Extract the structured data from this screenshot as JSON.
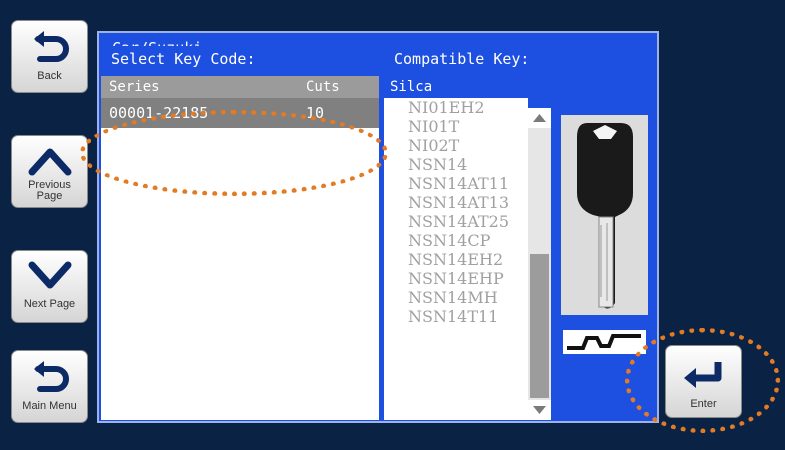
{
  "nav": {
    "back_label": "Back",
    "previous_label": "Previous\nPage",
    "next_label": "Next Page",
    "main_menu_label": "Main Menu",
    "enter_label": "Enter"
  },
  "panel": {
    "title": "Car/Suzuki",
    "select_header": "Select Key Code:",
    "compatible_header": "Compatible Key:"
  },
  "key_codes": {
    "columns": [
      "Series",
      "Cuts"
    ],
    "rows": [
      {
        "series": "00001-22185",
        "cuts": "10"
      }
    ]
  },
  "compatible": {
    "brand": "Silca",
    "items": [
      "NI01EH2",
      "NI01T",
      "NI02T",
      "NSN14",
      "NSN14AT11",
      "NSN14AT13",
      "NSN14AT25",
      "NSN14CP",
      "NSN14EH2",
      "NSN14EHP",
      "NSN14MH",
      "NSN14T11"
    ]
  },
  "colors": {
    "background": "#0a2244",
    "panel": "#1d4fe0",
    "selected_row": "#808080",
    "highlight": "#e37a24"
  },
  "icons": [
    "back-arrow-icon",
    "chevron-up-icon",
    "chevron-down-icon",
    "main-menu-arrow-icon",
    "enter-arrow-icon"
  ]
}
